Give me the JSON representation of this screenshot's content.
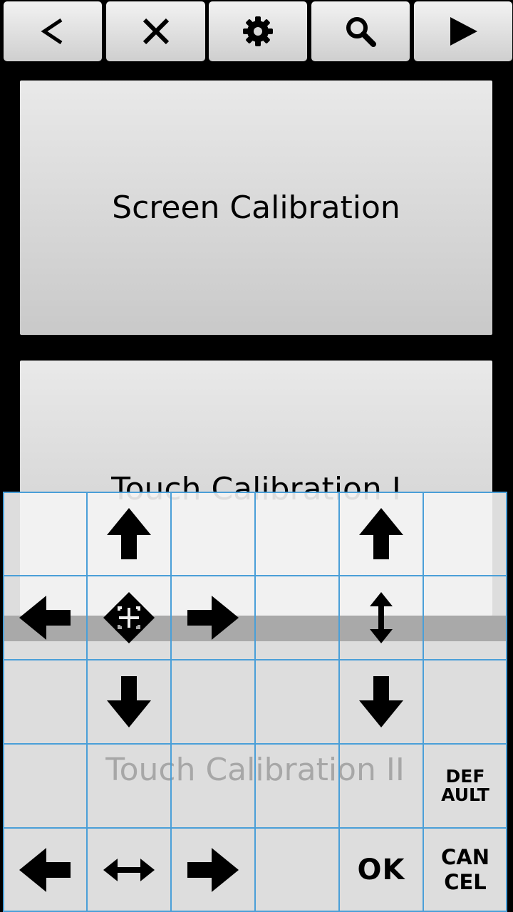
{
  "toolbar": {
    "back_label": "<",
    "close_label": "X",
    "buttons": [
      {
        "name": "back",
        "icon": "chevron-left-icon"
      },
      {
        "name": "close",
        "icon": "close-icon"
      },
      {
        "name": "settings",
        "icon": "gear-icon"
      },
      {
        "name": "search",
        "icon": "search-icon"
      },
      {
        "name": "play",
        "icon": "play-icon"
      }
    ]
  },
  "panels": {
    "screen_calibration": "Screen Calibration",
    "touch_calibration_1": "Touch Calibration I",
    "touch_calibration_2": "Touch Calibration II"
  },
  "controls": {
    "ok_label": "OK",
    "cancel_line1": "CAN",
    "cancel_line2": "CEL",
    "default_line1": "DEF",
    "default_line2": "AULT"
  },
  "colors": {
    "background": "#000000",
    "grid_line": "#4a9fd8",
    "button_face": "#dcdcdc",
    "overlay_text": "#a7a7a7"
  }
}
